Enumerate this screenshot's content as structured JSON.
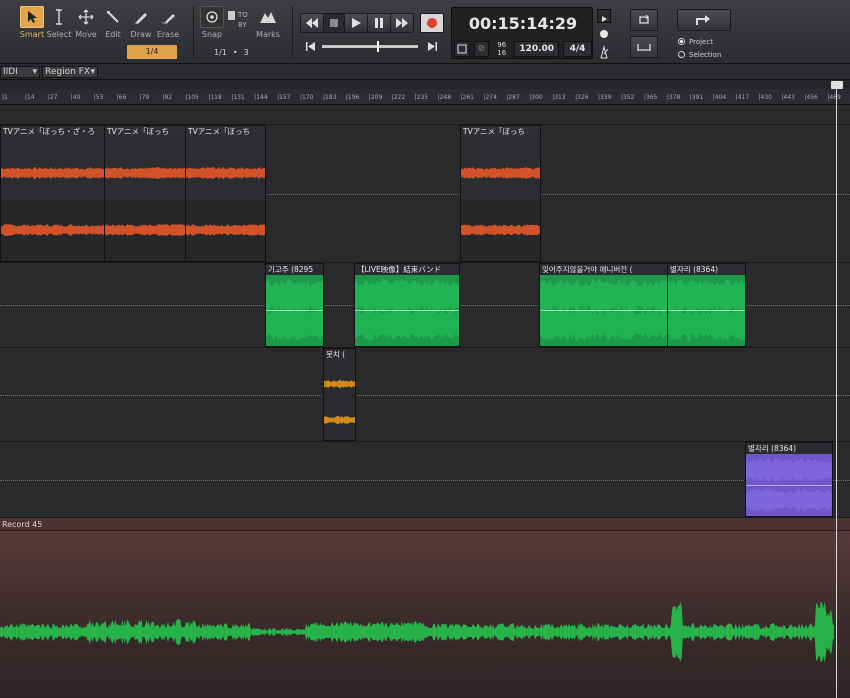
{
  "toolbar": {
    "tools": [
      {
        "key": "smart",
        "label": "Smart",
        "icon": "arrow-cursor-icon",
        "active": true
      },
      {
        "key": "select",
        "label": "Select",
        "icon": "i-beam-icon",
        "active": false
      },
      {
        "key": "move",
        "label": "Move",
        "icon": "move-cross-icon",
        "active": false
      },
      {
        "key": "edit",
        "label": "Edit",
        "icon": "edit-tool-icon",
        "active": false
      },
      {
        "key": "draw",
        "label": "Draw",
        "icon": "pencil-icon",
        "active": false
      },
      {
        "key": "erase",
        "label": "Erase",
        "icon": "eraser-icon",
        "active": false
      }
    ],
    "snap_value": "1/4",
    "snap_label": "Snap",
    "marks_label": "Marks",
    "to_label": "TO",
    "by_label": "BY",
    "snap_row": {
      "fraction": "1/1",
      "count": "3"
    },
    "time": "00:15:14:29",
    "time_sig_top": "96",
    "time_sig_bottom": "16",
    "tempo": "120.00",
    "meter": "4/4",
    "scope": {
      "project": "Project",
      "selection": "Selection",
      "selected": "project"
    }
  },
  "region_bar": {
    "track_dropdown": "IIDI",
    "fx_dropdown": "Region FX"
  },
  "ruler": {
    "ticks": [
      "1",
      "14",
      "27",
      "40",
      "53",
      "66",
      "79",
      "92",
      "105",
      "118",
      "131",
      "144",
      "157",
      "170",
      "183",
      "196",
      "209",
      "222",
      "235",
      "248",
      "261",
      "274",
      "287",
      "300",
      "313",
      "326",
      "339",
      "352",
      "365",
      "378",
      "391",
      "404",
      "417",
      "430",
      "443",
      "456",
      "469"
    ]
  },
  "tracks": {
    "orange_clips": [
      {
        "title": "TVアニメ「ぼっち・ざ・ろ"
      },
      {
        "title": "TVアニメ「ぼっち"
      },
      {
        "title": "TVアニメ「ぼっち"
      },
      {
        "title": "TVアニメ「ぼっち"
      }
    ],
    "green_clips": [
      {
        "title": "기고주 (8295"
      },
      {
        "title": "【LIVE映像】結束バンド"
      },
      {
        "title": "잊어주지않을거야 애니버전 ("
      },
      {
        "title": "별자리 (8364)"
      }
    ],
    "amber_clip": {
      "title": "못치 ("
    },
    "purple_clip": {
      "title": "별자리 (8364)"
    },
    "record_lane": {
      "title": "Record 45"
    }
  },
  "colors": {
    "accent": "#e2a64a",
    "orange_wave": "#d2522a",
    "green_clip": "#1d9a49",
    "amber_wave": "#d08a1a",
    "purple_clip": "#6e58c9",
    "record_wave": "#27b34a"
  }
}
